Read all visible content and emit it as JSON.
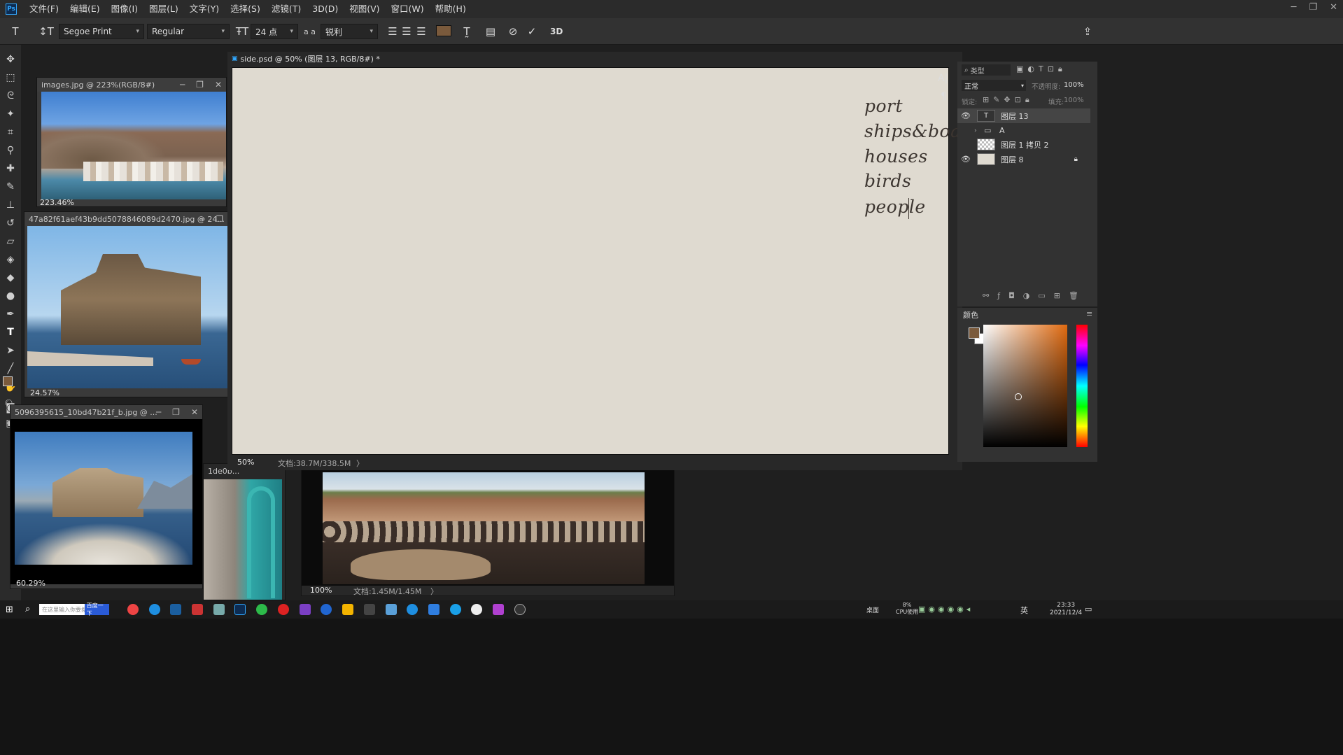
{
  "app": {
    "logo": "Ps"
  },
  "menu": [
    "文件(F)",
    "编辑(E)",
    "图像(I)",
    "图层(L)",
    "文字(Y)",
    "选择(S)",
    "滤镜(T)",
    "3D(D)",
    "视图(V)",
    "窗口(W)",
    "帮助(H)"
  ],
  "options": {
    "font_family": "Segoe Print",
    "font_style": "Regular",
    "font_size": "24 点",
    "aa_label": "a a",
    "antialias": "锐利",
    "text_color": "#7a5a3c",
    "threed_label": "3D"
  },
  "docs": {
    "images_jpg": {
      "title": "images.jpg @ 223%(RGB/8#)",
      "zoom": "223.46%"
    },
    "hash_jpg": {
      "title": "47a82f61aef43b9dd5078846089d2470.jpg @ 24...",
      "zoom": "24.57%"
    },
    "num_jpg": {
      "title": "5096395615_10bd47b21f_b.jpg @ ...",
      "zoom": "60.29%"
    },
    "partial": {
      "title": "1de0b..."
    },
    "side_psd": {
      "title": "side.psd @ 50% (图层 13, RGB/8#) *",
      "zoom": "50%",
      "docsize": "文档:38.7M/338.5M",
      "arrow": "〉"
    },
    "bottom": {
      "zoom": "100%",
      "docsize": "文档:1.45M/1.45M",
      "arrow": "〉"
    }
  },
  "canvas_words": [
    "port",
    "ships&boats",
    "houses",
    "birds",
    "people"
  ],
  "layers_panel": {
    "filter": "类型",
    "blend": "正常",
    "opacity_label": "不透明度:",
    "opacity": "100%",
    "lock_label": "锁定:",
    "fill_label": "填充:",
    "fill": "100%",
    "layers": [
      {
        "name": "图层 13",
        "visible": true,
        "selected": true,
        "kind": "text"
      },
      {
        "name": "A",
        "visible": false,
        "selected": false,
        "kind": "group"
      },
      {
        "name": "图层 1 拷贝 2",
        "visible": false,
        "selected": false,
        "kind": "pixel"
      },
      {
        "name": "图层 8",
        "visible": true,
        "selected": false,
        "kind": "fill",
        "locked": true
      }
    ]
  },
  "color_panel": {
    "title": "颜色",
    "fg": "#7a5a3c",
    "bg": "#ffffff"
  },
  "taskbar": {
    "search_placeholder": "在这里输入你要搜索的内容",
    "search_button": "百度一下",
    "desktop": "桌面",
    "cpu": "8%",
    "cpu_label": "CPU使用",
    "lang": "英",
    "time": "23:33",
    "date": "2021/12/4"
  }
}
